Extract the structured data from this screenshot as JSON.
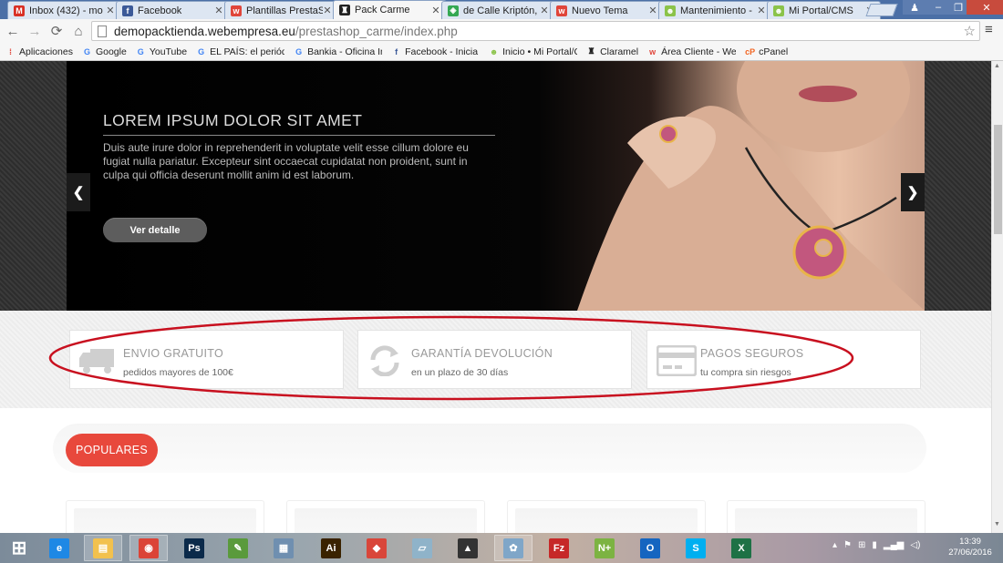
{
  "browser": {
    "tabs": [
      {
        "title": "Inbox (432) - mo",
        "icon": "gmail-icon",
        "color": "#d93025",
        "glyph": "M",
        "active": false
      },
      {
        "title": "Facebook",
        "icon": "facebook-icon",
        "color": "#3b5998",
        "glyph": "f",
        "active": false
      },
      {
        "title": "Plantillas PrestaS",
        "icon": "webempresa-icon",
        "color": "#e0453a",
        "glyph": "w",
        "active": false
      },
      {
        "title": "Pack Carme",
        "icon": "pack-carme-icon",
        "color": "#222222",
        "glyph": "♜",
        "active": true
      },
      {
        "title": "de Calle Kriptón,",
        "icon": "maps-icon",
        "color": "#34a853",
        "glyph": "◈",
        "active": false
      },
      {
        "title": "Nuevo Tema",
        "icon": "webempresa-icon",
        "color": "#e0453a",
        "glyph": "w",
        "active": false
      },
      {
        "title": "Mantenimiento -",
        "icon": "prestashop-icon",
        "color": "#8bc34a",
        "glyph": "☻",
        "active": false
      },
      {
        "title": "Mi Portal/CMS",
        "icon": "prestashop-icon",
        "color": "#8bc34a",
        "glyph": "☻",
        "active": false
      }
    ],
    "url_host": "demopacktienda.webempresa.eu",
    "url_path": "/prestashop_carme/index.php",
    "bookmarks": [
      {
        "label": "Aplicaciones",
        "icon": "apps-grid-icon",
        "color": "#e0453a",
        "glyph": "⁞"
      },
      {
        "label": "Google",
        "icon": "google-icon",
        "color": "#4285f4",
        "glyph": "G"
      },
      {
        "label": "YouTube",
        "icon": "google-icon",
        "color": "#4285f4",
        "glyph": "G"
      },
      {
        "label": "EL PAÍS: el periódico g",
        "icon": "google-icon",
        "color": "#4285f4",
        "glyph": "G"
      },
      {
        "label": "Bankia - Oficina Intern",
        "icon": "google-icon",
        "color": "#4285f4",
        "glyph": "G"
      },
      {
        "label": "Facebook - Inicia sesió",
        "icon": "facebook-icon",
        "color": "#3b5998",
        "glyph": "f"
      },
      {
        "label": "Inicio • Mi Portal/CMS",
        "icon": "prestashop-icon",
        "color": "#8bc34a",
        "glyph": "☻"
      },
      {
        "label": "Claramel",
        "icon": "pack-carme-icon",
        "color": "#222222",
        "glyph": "♜"
      },
      {
        "label": "Área Cliente - Webem",
        "icon": "webempresa-icon",
        "color": "#e0453a",
        "glyph": "w"
      },
      {
        "label": "cPanel",
        "icon": "cpanel-icon",
        "color": "#f26522",
        "glyph": "cP"
      }
    ]
  },
  "hero": {
    "title": "LOREM IPSUM DOLOR SIT AMET",
    "text": "Duis aute irure dolor in reprehenderit in voluptate velit esse cillum dolore eu fugiat nulla pariatur. Excepteur sint occaecat cupidatat non proident, sunt in culpa qui officia deserunt mollit anim id est laborum.",
    "button": "Ver detalle",
    "prev": "❮",
    "next": "❯"
  },
  "features": [
    {
      "title": "ENVIO GRATUITO",
      "subtitle": "pedidos mayores de 100€",
      "icon": "truck-icon"
    },
    {
      "title": "GARANTÍA DEVOLUCIÓN",
      "subtitle": "en un plazo de 30 días",
      "icon": "refresh-icon"
    },
    {
      "title": "PAGOS SEGUROS",
      "subtitle": "tu compra sin riesgos",
      "icon": "credit-card-icon"
    }
  ],
  "popular": {
    "label": "POPULARES"
  },
  "colors": {
    "accent": "#e8483c",
    "annotation": "#c8101f"
  },
  "taskbar": {
    "apps": [
      {
        "name": "start-icon",
        "glyph": "⊞",
        "color": "#ffffff",
        "open": false
      },
      {
        "name": "internet-explorer-icon",
        "glyph": "e",
        "color": "#1e88e5",
        "open": false
      },
      {
        "name": "file-explorer-icon",
        "glyph": "▤",
        "color": "#f2c14e",
        "open": true
      },
      {
        "name": "chrome-icon",
        "glyph": "◉",
        "color": "#db4437",
        "open": true
      },
      {
        "name": "photoshop-icon",
        "glyph": "Ps",
        "color": "#0b2a4a",
        "open": false
      },
      {
        "name": "corel-icon",
        "glyph": "✎",
        "color": "#5a9a3c",
        "open": false
      },
      {
        "name": "calculator-icon",
        "glyph": "▦",
        "color": "#6f8fb0",
        "open": false
      },
      {
        "name": "illustrator-icon",
        "glyph": "Ai",
        "color": "#3a2200",
        "open": false
      },
      {
        "name": "sticky-notes-icon",
        "glyph": "◆",
        "color": "#d9463a",
        "open": false
      },
      {
        "name": "notepad-icon",
        "glyph": "▱",
        "color": "#8fb3c9",
        "open": false
      },
      {
        "name": "inkscape-icon",
        "glyph": "▲",
        "color": "#333333",
        "open": false
      },
      {
        "name": "paint-icon",
        "glyph": "✿",
        "color": "#7fa6c8",
        "open": true
      },
      {
        "name": "filezilla-icon",
        "glyph": "Fz",
        "color": "#c62828",
        "open": false
      },
      {
        "name": "notepadpp-icon",
        "glyph": "N+",
        "color": "#7cb342",
        "open": false
      },
      {
        "name": "outlook-icon",
        "glyph": "O",
        "color": "#1565c0",
        "open": false
      },
      {
        "name": "skype-icon",
        "glyph": "S",
        "color": "#00aff0",
        "open": false
      },
      {
        "name": "excel-icon",
        "glyph": "X",
        "color": "#1e7145",
        "open": false
      }
    ],
    "clock_time": "13:39",
    "clock_date": "27/06/2016"
  }
}
